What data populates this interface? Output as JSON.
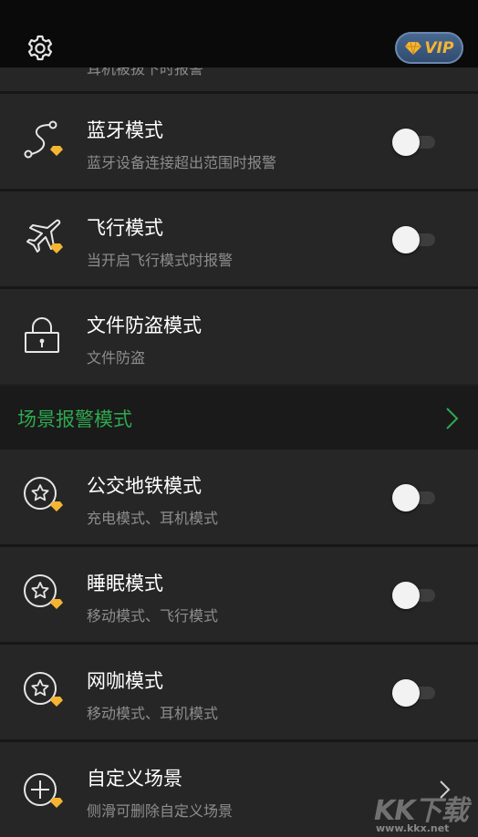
{
  "header": {
    "vip_label": "VIP"
  },
  "partial_row": {
    "subtitle": "耳机被拔下时报警"
  },
  "rows": [
    {
      "title": "蓝牙模式",
      "subtitle": "蓝牙设备连接超出范围时报警",
      "icon": "bluetooth-route-icon",
      "toggle_on": false
    },
    {
      "title": "飞行模式",
      "subtitle": "当开启飞行模式时报警",
      "icon": "airplane-icon",
      "toggle_on": false
    },
    {
      "title": "文件防盗模式",
      "subtitle": "文件防盗",
      "icon": "lock-icon"
    }
  ],
  "scene_section": {
    "title": "场景报警模式"
  },
  "scene_rows": [
    {
      "title": "公交地铁模式",
      "subtitle": "充电模式、耳机模式",
      "icon": "star-circle-icon",
      "toggle_on": false
    },
    {
      "title": "睡眠模式",
      "subtitle": "移动模式、飞行模式",
      "icon": "star-circle-icon",
      "toggle_on": false
    },
    {
      "title": "网咖模式",
      "subtitle": "移动模式、耳机模式",
      "icon": "star-circle-icon",
      "toggle_on": false
    },
    {
      "title": "自定义场景",
      "subtitle": "侧滑可删除自定义场景",
      "icon": "plus-circle-icon"
    }
  ],
  "watermark": {
    "brand": "KK下载",
    "url": "www.kkx.net"
  },
  "colors": {
    "accent_green": "#2fa84f",
    "vip_gold": "#f5b531",
    "background": "#202020",
    "row_background": "#262626"
  }
}
